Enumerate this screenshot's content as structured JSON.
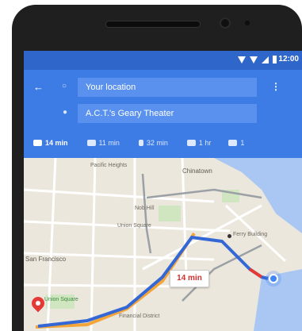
{
  "status_bar": {
    "time": "12:00",
    "icons": [
      "bluetooth-icon",
      "wifi-icon",
      "cell-signal-icon",
      "battery-icon"
    ]
  },
  "directions": {
    "back_icon": "back-arrow-icon",
    "origin_icon": "origin-dot-icon",
    "destination_icon": "location-pin-icon",
    "origin": "Your location",
    "destination": "A.C.T.'s Geary Theater",
    "menu_icon": "more-vert-icon"
  },
  "travel_modes": [
    {
      "icon": "car-icon",
      "label": "14 min"
    },
    {
      "icon": "transit-icon",
      "label": "11 min"
    },
    {
      "icon": "walk-icon",
      "label": "32 min"
    },
    {
      "icon": "ride-icon",
      "label": "1 hr"
    },
    {
      "icon": "bike-icon",
      "label": "1"
    }
  ],
  "map": {
    "labels": [
      "Pacific Heights",
      "Chinatown",
      "Nob Hill",
      "Union Square",
      "San Francisco",
      "Ferry Building",
      "Union Square",
      "Financial District"
    ],
    "route_time": "14 min",
    "route_color": "#3367d6",
    "alt_route_color": "#f4a53a",
    "traffic_color": "#e53935"
  }
}
